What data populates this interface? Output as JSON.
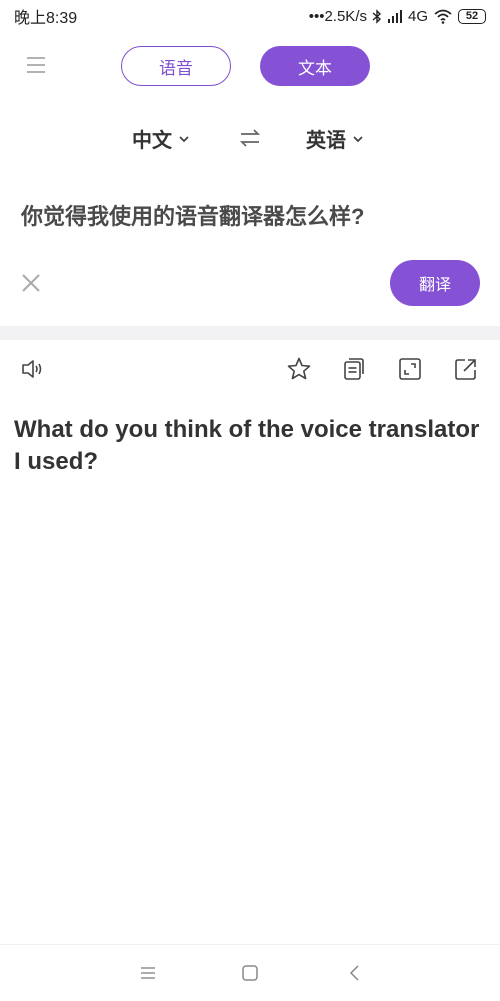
{
  "status_bar": {
    "time": "晚上8:39",
    "network_speed": "•••2.5K/s",
    "network_type": "4G",
    "battery": "52",
    "icons": [
      "bluetooth-icon",
      "signal-icon",
      "wifi-icon",
      "battery-icon"
    ]
  },
  "header": {
    "menu_icon": "hamburger-menu-icon",
    "tabs": [
      {
        "label": "语音",
        "active": false
      },
      {
        "label": "文本",
        "active": true
      }
    ]
  },
  "languages": {
    "source": "中文",
    "target": "英语",
    "swap_icon": "swap-arrows-icon"
  },
  "input": {
    "text": "你觉得我使用的语音翻译器怎么样?",
    "clear_icon": "close-icon",
    "translate_label": "翻译"
  },
  "result": {
    "text": "What do you think of the voice translator I used?",
    "toolbar_icons": [
      "speaker-icon",
      "star-icon",
      "copy-icon",
      "fullscreen-icon",
      "share-icon"
    ]
  },
  "bottom_nav": {
    "icons": [
      "recents-menu-icon",
      "home-square-icon",
      "back-chevron-icon"
    ]
  },
  "colors": {
    "accent": "#8552d6",
    "divider": "#f2f2f4",
    "text": "#333333"
  }
}
